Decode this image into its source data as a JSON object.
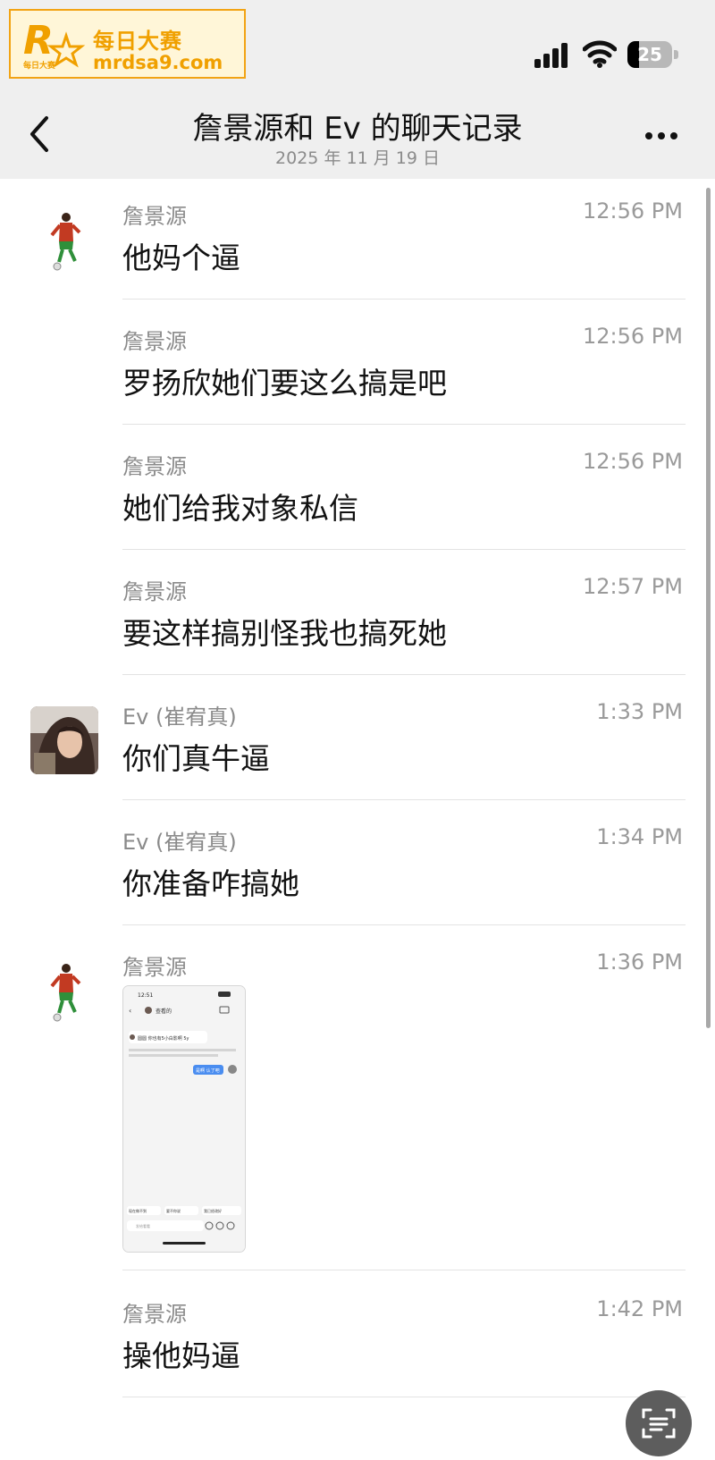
{
  "watermark": {
    "title": "每日大赛",
    "url": "mrdsa9.com",
    "logo_letter": "R",
    "logo_text": "每日大赛"
  },
  "status_bar": {
    "battery": "25",
    "battery_level": 0.25
  },
  "header": {
    "back_icon": "chevron-left-icon",
    "title": "詹景源和 Ev 的聊天记录",
    "subtitle": "2025 年 11 月 19 日",
    "more_icon": "more-icon"
  },
  "messages": [
    {
      "sender": "詹景源",
      "time": "12:56 PM",
      "text": "他妈个逼",
      "avatar": "soccer-player"
    },
    {
      "sender": "詹景源",
      "time": "12:56 PM",
      "text": "罗扬欣她们要这么搞是吧"
    },
    {
      "sender": "詹景源",
      "time": "12:56 PM",
      "text": "她们给我对象私信"
    },
    {
      "sender": "詹景源",
      "time": "12:57 PM",
      "text": "要这样搞别怪我也搞死她"
    },
    {
      "sender": "Ev (崔宥真)",
      "time": "1:33 PM",
      "text": "你们真牛逼",
      "avatar": "woman-photo"
    },
    {
      "sender": "Ev (崔宥真)",
      "time": "1:34 PM",
      "text": "你准备咋搞她"
    },
    {
      "sender": "詹景源",
      "time": "1:36 PM",
      "image": "screenshot-thumbnail",
      "avatar": "soccer-player"
    },
    {
      "sender": "詹景源",
      "time": "1:42 PM",
      "text": "操他妈逼"
    }
  ],
  "screenshot_thumb": {
    "time": "12:51",
    "title": "查看的",
    "line1": "圆圆 你也有5小白影啊 5y",
    "bubble": "是啊 认了吧",
    "chips": [
      "现在做不到",
      "要不你说",
      "我已经改好"
    ],
    "input_placeholder": "发给看看"
  },
  "fab": {
    "icon": "text-scan-icon"
  },
  "colors": {
    "accent_orange": "#f0a000",
    "bar_bg": "#efefef",
    "muted_text": "#8a8a8a",
    "jersey_red": "#c23a22",
    "jersey_green": "#2f8f3a"
  }
}
